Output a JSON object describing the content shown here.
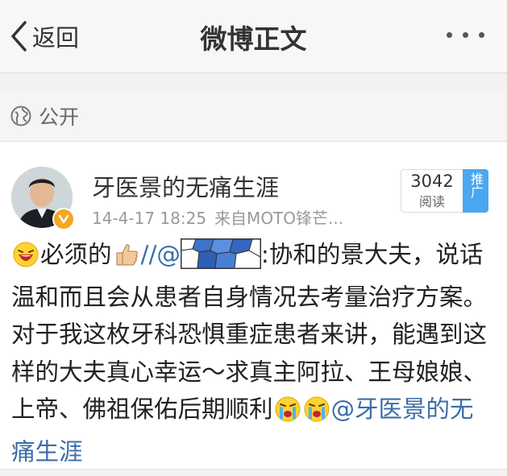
{
  "nav": {
    "back_label": "返回",
    "title": "微博正文"
  },
  "visibility": {
    "label": "公开",
    "icon": "globe-icon"
  },
  "post": {
    "username": "牙医景的无痛生涯",
    "timestamp": "14-4-17 18:25",
    "source": "来自MOTO锋芒...",
    "read_count": "3042",
    "read_label": "阅读",
    "promote_label": "推广",
    "verified_color": "#f5a623",
    "content": {
      "part1": "必须的",
      "part2": "//@",
      "part3": ":协和的景大夫，说话温和而且会从患者自身情况去考量治疗方案。对于我这枚牙科恐惧重症患者来讲，能遇到这样的大夫真心幸运～求真主阿拉、王母娘娘、上帝、佛祖保佑后期顺利",
      "mention": "@牙医景的无痛生涯"
    }
  },
  "colors": {
    "link": "#3b6ea8",
    "promote_bg": "#4aa7f0"
  }
}
